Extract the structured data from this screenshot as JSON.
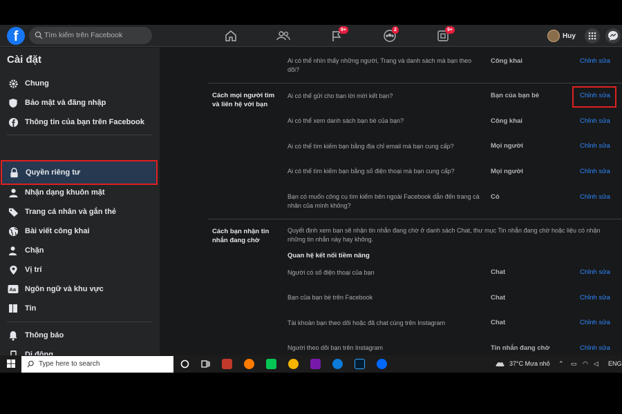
{
  "topbar": {
    "logo": "f",
    "search_placeholder": "Tìm kiếm trên Facebook",
    "badges": {
      "watch": "9+",
      "groups": "2",
      "gaming": "9+"
    },
    "profile_name": "Huy"
  },
  "sidebar": {
    "title": "Cài đặt",
    "items": [
      {
        "label": "Chung",
        "icon": "gear-icon"
      },
      {
        "label": "Bảo mật và đăng nhập",
        "icon": "shield-icon"
      },
      {
        "label": "Thông tin của bạn trên Facebook",
        "icon": "facebook-icon"
      },
      {
        "label": "Quyền riêng tư",
        "icon": "lock-icon"
      },
      {
        "label": "Nhận dạng khuôn mặt",
        "icon": "face-icon"
      },
      {
        "label": "Trang cá nhân và gắn thẻ",
        "icon": "tag-icon"
      },
      {
        "label": "Bài viết công khai",
        "icon": "globe-icon"
      },
      {
        "label": "Chặn",
        "icon": "block-user-icon"
      },
      {
        "label": "Vị trí",
        "icon": "location-pin-icon"
      },
      {
        "label": "Ngôn ngữ và khu vực",
        "icon": "language-icon"
      },
      {
        "label": "Tin",
        "icon": "book-icon"
      },
      {
        "label": "Thông báo",
        "icon": "bell-icon"
      },
      {
        "label": "Di động",
        "icon": "mobile-icon"
      }
    ]
  },
  "main": {
    "rows": [
      {
        "q": "Ai có thể nhìn thấy những người, Trang và danh sách mà bạn theo dõi?",
        "v": "Công khai",
        "e": "Chỉnh sửa"
      },
      {
        "q": "Ai có thể gửi cho bạn lời mời kết bạn?",
        "v": "Bạn của bạn bè",
        "e": "Chỉnh sửa"
      },
      {
        "q": "Ai có thể xem danh sách bạn bè của bạn?",
        "v": "Công khai",
        "e": "Chỉnh sửa"
      },
      {
        "q": "Ai có thể tìm kiếm bạn bằng địa chỉ email mà bạn cung cấp?",
        "v": "Mọi người",
        "e": "Chỉnh sửa"
      },
      {
        "q": "Ai có thể tìm kiếm bạn bằng số điện thoại mà bạn cung cấp?",
        "v": "Mọi người",
        "e": "Chỉnh sửa"
      },
      {
        "q": "Bạn có muốn công cụ tìm kiếm bên ngoài Facebook dẫn đến trang cá nhân của mình không?",
        "v": "Có",
        "e": "Chỉnh sửa"
      }
    ],
    "section1": "Cách mọi người tìm và liên hệ với bạn",
    "section2": "Cách bạn nhận tin nhắn đang chờ",
    "section2_desc": "Quyết định xem bạn sẽ nhận tin nhắn đang chờ ở danh sách Chat, thư mục Tin nhắn đang chờ hoặc liệu có nhận những tin nhắn này hay không.",
    "subhead": "Quan hệ kết nối tiềm năng",
    "msg_rows": [
      {
        "q": "Người có số điện thoại của bạn",
        "v": "Chat",
        "e": "Chỉnh sửa"
      },
      {
        "q": "Bạn của bạn bè trên Facebook",
        "v": "Chat",
        "e": "Chỉnh sửa"
      },
      {
        "q": "Tài khoản bạn theo dõi hoặc đã chat cùng trên Instagram",
        "v": "Chat",
        "e": "Chỉnh sửa"
      },
      {
        "q": "Người theo dõi bạn trên Instagram",
        "v": "Tin nhắn đang chờ",
        "e": "Chỉnh sửa"
      }
    ]
  },
  "taskbar": {
    "search_placeholder": "Type here to search",
    "weather": "37°C  Mưa nhỏ",
    "lang": "ENG"
  }
}
